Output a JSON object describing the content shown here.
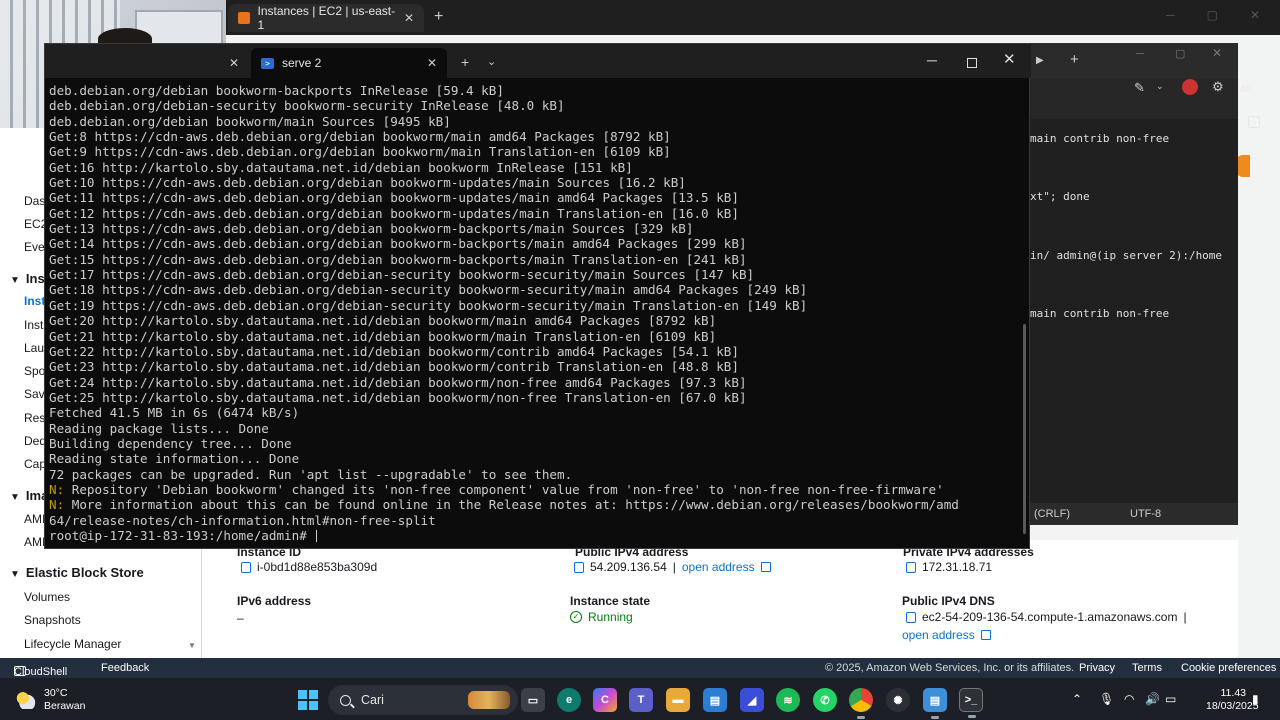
{
  "browser": {
    "tab_title": "Instances | EC2 | us-east-1",
    "tab_close": "✕",
    "new_tab": "+"
  },
  "aws": {
    "sidebar": {
      "fragments": [
        "Das",
        "EC2",
        "Eve"
      ],
      "section_instances": "Ins",
      "instances_items": [
        "Inst",
        "Inst",
        "Lau",
        "Spo",
        "Sav",
        "Res",
        "Ded",
        "Cap"
      ],
      "section_images": "Ima",
      "images_items": [
        "AMI",
        "AMI"
      ],
      "section_ebs": "Elastic Block Store",
      "ebs_items": [
        "Volumes",
        "Snapshots",
        "Lifecycle Manager"
      ]
    },
    "details": {
      "instance_id_label": "Instance ID",
      "instance_id": "i-0bd1d88e853ba309d",
      "public_ipv4_label": "Public IPv4 address",
      "public_ipv4": "54.209.136.54",
      "open_address": "open address",
      "private_ipv4_label": "Private IPv4 addresses",
      "private_ipv4": "172.31.18.71",
      "ipv6_label": "IPv6 address",
      "ipv6_value": "–",
      "state_label": "Instance state",
      "state_value": "Running",
      "dns_label": "Public IPv4 DNS",
      "dns_value": "ec2-54-209-136-54.compute-1.amazonaws.com",
      "dns_open": "open address"
    },
    "footer": {
      "cloudshell": "CloudShell",
      "feedback": "Feedback",
      "copyright": "© 2025, Amazon Web Services, Inc. or its affiliates.",
      "privacy": "Privacy",
      "terms": "Terms",
      "cookies": "Cookie preferences"
    }
  },
  "editor": {
    "lines": [
      "main contrib non-free",
      "xt\"; done",
      "in/ admin@(ip server 2):/home",
      "main contrib non-free"
    ],
    "status_crlf": "(CRLF)",
    "status_encoding": "UTF-8",
    "zoom": "40"
  },
  "terminal": {
    "tab_title": "serve 2",
    "lines": [
      {
        "p": "",
        "t": "deb.debian.org/debian bookworm-backports InRelease [59.4 kB]"
      },
      {
        "p": "",
        "t": "deb.debian.org/debian-security bookworm-security InRelease [48.0 kB]"
      },
      {
        "p": "",
        "t": "deb.debian.org/debian bookworm/main Sources [9495 kB]"
      },
      {
        "p": "",
        "t": "Get:8 https://cdn-aws.deb.debian.org/debian bookworm/main amd64 Packages [8792 kB]"
      },
      {
        "p": "",
        "t": "Get:9 https://cdn-aws.deb.debian.org/debian bookworm/main Translation-en [6109 kB]"
      },
      {
        "p": "",
        "t": "Get:16 http://kartolo.sby.datautama.net.id/debian bookworm InRelease [151 kB]"
      },
      {
        "p": "",
        "t": "Get:10 https://cdn-aws.deb.debian.org/debian bookworm-updates/main Sources [16.2 kB]"
      },
      {
        "p": "",
        "t": "Get:11 https://cdn-aws.deb.debian.org/debian bookworm-updates/main amd64 Packages [13.5 kB]"
      },
      {
        "p": "",
        "t": "Get:12 https://cdn-aws.deb.debian.org/debian bookworm-updates/main Translation-en [16.0 kB]"
      },
      {
        "p": "",
        "t": "Get:13 https://cdn-aws.deb.debian.org/debian bookworm-backports/main Sources [329 kB]"
      },
      {
        "p": "",
        "t": "Get:14 https://cdn-aws.deb.debian.org/debian bookworm-backports/main amd64 Packages [299 kB]"
      },
      {
        "p": "",
        "t": "Get:15 https://cdn-aws.deb.debian.org/debian bookworm-backports/main Translation-en [241 kB]"
      },
      {
        "p": "",
        "t": "Get:17 https://cdn-aws.deb.debian.org/debian-security bookworm-security/main Sources [147 kB]"
      },
      {
        "p": "",
        "t": "Get:18 https://cdn-aws.deb.debian.org/debian-security bookworm-security/main amd64 Packages [249 kB]"
      },
      {
        "p": "",
        "t": "Get:19 https://cdn-aws.deb.debian.org/debian-security bookworm-security/main Translation-en [149 kB]"
      },
      {
        "p": "",
        "t": "Get:20 http://kartolo.sby.datautama.net.id/debian bookworm/main amd64 Packages [8792 kB]"
      },
      {
        "p": "",
        "t": "Get:21 http://kartolo.sby.datautama.net.id/debian bookworm/main Translation-en [6109 kB]"
      },
      {
        "p": "",
        "t": "Get:22 http://kartolo.sby.datautama.net.id/debian bookworm/contrib amd64 Packages [54.1 kB]"
      },
      {
        "p": "",
        "t": "Get:23 http://kartolo.sby.datautama.net.id/debian bookworm/contrib Translation-en [48.8 kB]"
      },
      {
        "p": "",
        "t": "Get:24 http://kartolo.sby.datautama.net.id/debian bookworm/non-free amd64 Packages [97.3 kB]"
      },
      {
        "p": "",
        "t": "Get:25 http://kartolo.sby.datautama.net.id/debian bookworm/non-free Translation-en [67.0 kB]"
      },
      {
        "p": "",
        "t": "Fetched 41.5 MB in 6s (6474 kB/s)"
      },
      {
        "p": "",
        "t": "Reading package lists... Done"
      },
      {
        "p": "",
        "t": "Building dependency tree... Done"
      },
      {
        "p": "",
        "t": "Reading state information... Done"
      },
      {
        "p": "",
        "t": "72 packages can be upgraded. Run 'apt list --upgradable' to see them."
      },
      {
        "p": "N: ",
        "t": "Repository 'Debian bookworm' changed its 'non-free component' value from 'non-free' to 'non-free non-free-firmware'"
      },
      {
        "p": "N: ",
        "t": "More information about this can be found online in the Release notes at: https://www.debian.org/releases/bookworm/amd"
      },
      {
        "p": "",
        "t": "64/release-notes/ch-information.html#non-free-split"
      }
    ],
    "prompt": "root@ip-172-31-83-193:/home/admin# "
  },
  "taskbar": {
    "temperature": "30°C",
    "weather": "Berawan",
    "search_placeholder": "Cari",
    "time": "11.43",
    "date": "18/03/2025"
  },
  "colors": {
    "aws_link": "#0972d3",
    "running_green": "#037f0c",
    "terminal_bg": "#0c0c0c",
    "notice_yellow": "#c19c00"
  }
}
